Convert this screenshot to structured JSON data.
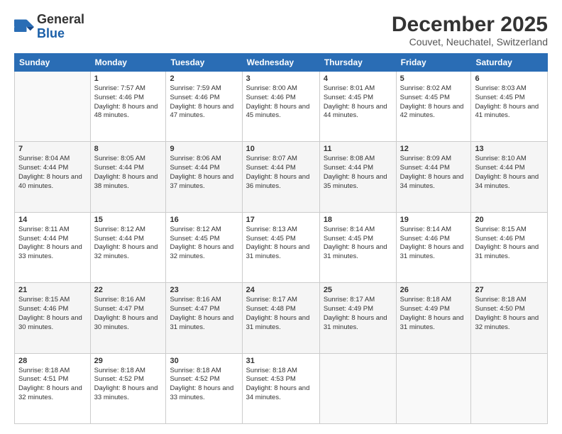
{
  "logo": {
    "general": "General",
    "blue": "Blue"
  },
  "header": {
    "title": "December 2025",
    "subtitle": "Couvet, Neuchatel, Switzerland"
  },
  "days_header": [
    "Sunday",
    "Monday",
    "Tuesday",
    "Wednesday",
    "Thursday",
    "Friday",
    "Saturday"
  ],
  "weeks": [
    [
      {
        "day": "",
        "sunrise": "",
        "sunset": "",
        "daylight": ""
      },
      {
        "day": "1",
        "sunrise": "Sunrise: 7:57 AM",
        "sunset": "Sunset: 4:46 PM",
        "daylight": "Daylight: 8 hours and 48 minutes."
      },
      {
        "day": "2",
        "sunrise": "Sunrise: 7:59 AM",
        "sunset": "Sunset: 4:46 PM",
        "daylight": "Daylight: 8 hours and 47 minutes."
      },
      {
        "day": "3",
        "sunrise": "Sunrise: 8:00 AM",
        "sunset": "Sunset: 4:46 PM",
        "daylight": "Daylight: 8 hours and 45 minutes."
      },
      {
        "day": "4",
        "sunrise": "Sunrise: 8:01 AM",
        "sunset": "Sunset: 4:45 PM",
        "daylight": "Daylight: 8 hours and 44 minutes."
      },
      {
        "day": "5",
        "sunrise": "Sunrise: 8:02 AM",
        "sunset": "Sunset: 4:45 PM",
        "daylight": "Daylight: 8 hours and 42 minutes."
      },
      {
        "day": "6",
        "sunrise": "Sunrise: 8:03 AM",
        "sunset": "Sunset: 4:45 PM",
        "daylight": "Daylight: 8 hours and 41 minutes."
      }
    ],
    [
      {
        "day": "7",
        "sunrise": "Sunrise: 8:04 AM",
        "sunset": "Sunset: 4:44 PM",
        "daylight": "Daylight: 8 hours and 40 minutes."
      },
      {
        "day": "8",
        "sunrise": "Sunrise: 8:05 AM",
        "sunset": "Sunset: 4:44 PM",
        "daylight": "Daylight: 8 hours and 38 minutes."
      },
      {
        "day": "9",
        "sunrise": "Sunrise: 8:06 AM",
        "sunset": "Sunset: 4:44 PM",
        "daylight": "Daylight: 8 hours and 37 minutes."
      },
      {
        "day": "10",
        "sunrise": "Sunrise: 8:07 AM",
        "sunset": "Sunset: 4:44 PM",
        "daylight": "Daylight: 8 hours and 36 minutes."
      },
      {
        "day": "11",
        "sunrise": "Sunrise: 8:08 AM",
        "sunset": "Sunset: 4:44 PM",
        "daylight": "Daylight: 8 hours and 35 minutes."
      },
      {
        "day": "12",
        "sunrise": "Sunrise: 8:09 AM",
        "sunset": "Sunset: 4:44 PM",
        "daylight": "Daylight: 8 hours and 34 minutes."
      },
      {
        "day": "13",
        "sunrise": "Sunrise: 8:10 AM",
        "sunset": "Sunset: 4:44 PM",
        "daylight": "Daylight: 8 hours and 34 minutes."
      }
    ],
    [
      {
        "day": "14",
        "sunrise": "Sunrise: 8:11 AM",
        "sunset": "Sunset: 4:44 PM",
        "daylight": "Daylight: 8 hours and 33 minutes."
      },
      {
        "day": "15",
        "sunrise": "Sunrise: 8:12 AM",
        "sunset": "Sunset: 4:44 PM",
        "daylight": "Daylight: 8 hours and 32 minutes."
      },
      {
        "day": "16",
        "sunrise": "Sunrise: 8:12 AM",
        "sunset": "Sunset: 4:45 PM",
        "daylight": "Daylight: 8 hours and 32 minutes."
      },
      {
        "day": "17",
        "sunrise": "Sunrise: 8:13 AM",
        "sunset": "Sunset: 4:45 PM",
        "daylight": "Daylight: 8 hours and 31 minutes."
      },
      {
        "day": "18",
        "sunrise": "Sunrise: 8:14 AM",
        "sunset": "Sunset: 4:45 PM",
        "daylight": "Daylight: 8 hours and 31 minutes."
      },
      {
        "day": "19",
        "sunrise": "Sunrise: 8:14 AM",
        "sunset": "Sunset: 4:46 PM",
        "daylight": "Daylight: 8 hours and 31 minutes."
      },
      {
        "day": "20",
        "sunrise": "Sunrise: 8:15 AM",
        "sunset": "Sunset: 4:46 PM",
        "daylight": "Daylight: 8 hours and 31 minutes."
      }
    ],
    [
      {
        "day": "21",
        "sunrise": "Sunrise: 8:15 AM",
        "sunset": "Sunset: 4:46 PM",
        "daylight": "Daylight: 8 hours and 30 minutes."
      },
      {
        "day": "22",
        "sunrise": "Sunrise: 8:16 AM",
        "sunset": "Sunset: 4:47 PM",
        "daylight": "Daylight: 8 hours and 30 minutes."
      },
      {
        "day": "23",
        "sunrise": "Sunrise: 8:16 AM",
        "sunset": "Sunset: 4:47 PM",
        "daylight": "Daylight: 8 hours and 31 minutes."
      },
      {
        "day": "24",
        "sunrise": "Sunrise: 8:17 AM",
        "sunset": "Sunset: 4:48 PM",
        "daylight": "Daylight: 8 hours and 31 minutes."
      },
      {
        "day": "25",
        "sunrise": "Sunrise: 8:17 AM",
        "sunset": "Sunset: 4:49 PM",
        "daylight": "Daylight: 8 hours and 31 minutes."
      },
      {
        "day": "26",
        "sunrise": "Sunrise: 8:18 AM",
        "sunset": "Sunset: 4:49 PM",
        "daylight": "Daylight: 8 hours and 31 minutes."
      },
      {
        "day": "27",
        "sunrise": "Sunrise: 8:18 AM",
        "sunset": "Sunset: 4:50 PM",
        "daylight": "Daylight: 8 hours and 32 minutes."
      }
    ],
    [
      {
        "day": "28",
        "sunrise": "Sunrise: 8:18 AM",
        "sunset": "Sunset: 4:51 PM",
        "daylight": "Daylight: 8 hours and 32 minutes."
      },
      {
        "day": "29",
        "sunrise": "Sunrise: 8:18 AM",
        "sunset": "Sunset: 4:52 PM",
        "daylight": "Daylight: 8 hours and 33 minutes."
      },
      {
        "day": "30",
        "sunrise": "Sunrise: 8:18 AM",
        "sunset": "Sunset: 4:52 PM",
        "daylight": "Daylight: 8 hours and 33 minutes."
      },
      {
        "day": "31",
        "sunrise": "Sunrise: 8:18 AM",
        "sunset": "Sunset: 4:53 PM",
        "daylight": "Daylight: 8 hours and 34 minutes."
      },
      {
        "day": "",
        "sunrise": "",
        "sunset": "",
        "daylight": ""
      },
      {
        "day": "",
        "sunrise": "",
        "sunset": "",
        "daylight": ""
      },
      {
        "day": "",
        "sunrise": "",
        "sunset": "",
        "daylight": ""
      }
    ]
  ]
}
